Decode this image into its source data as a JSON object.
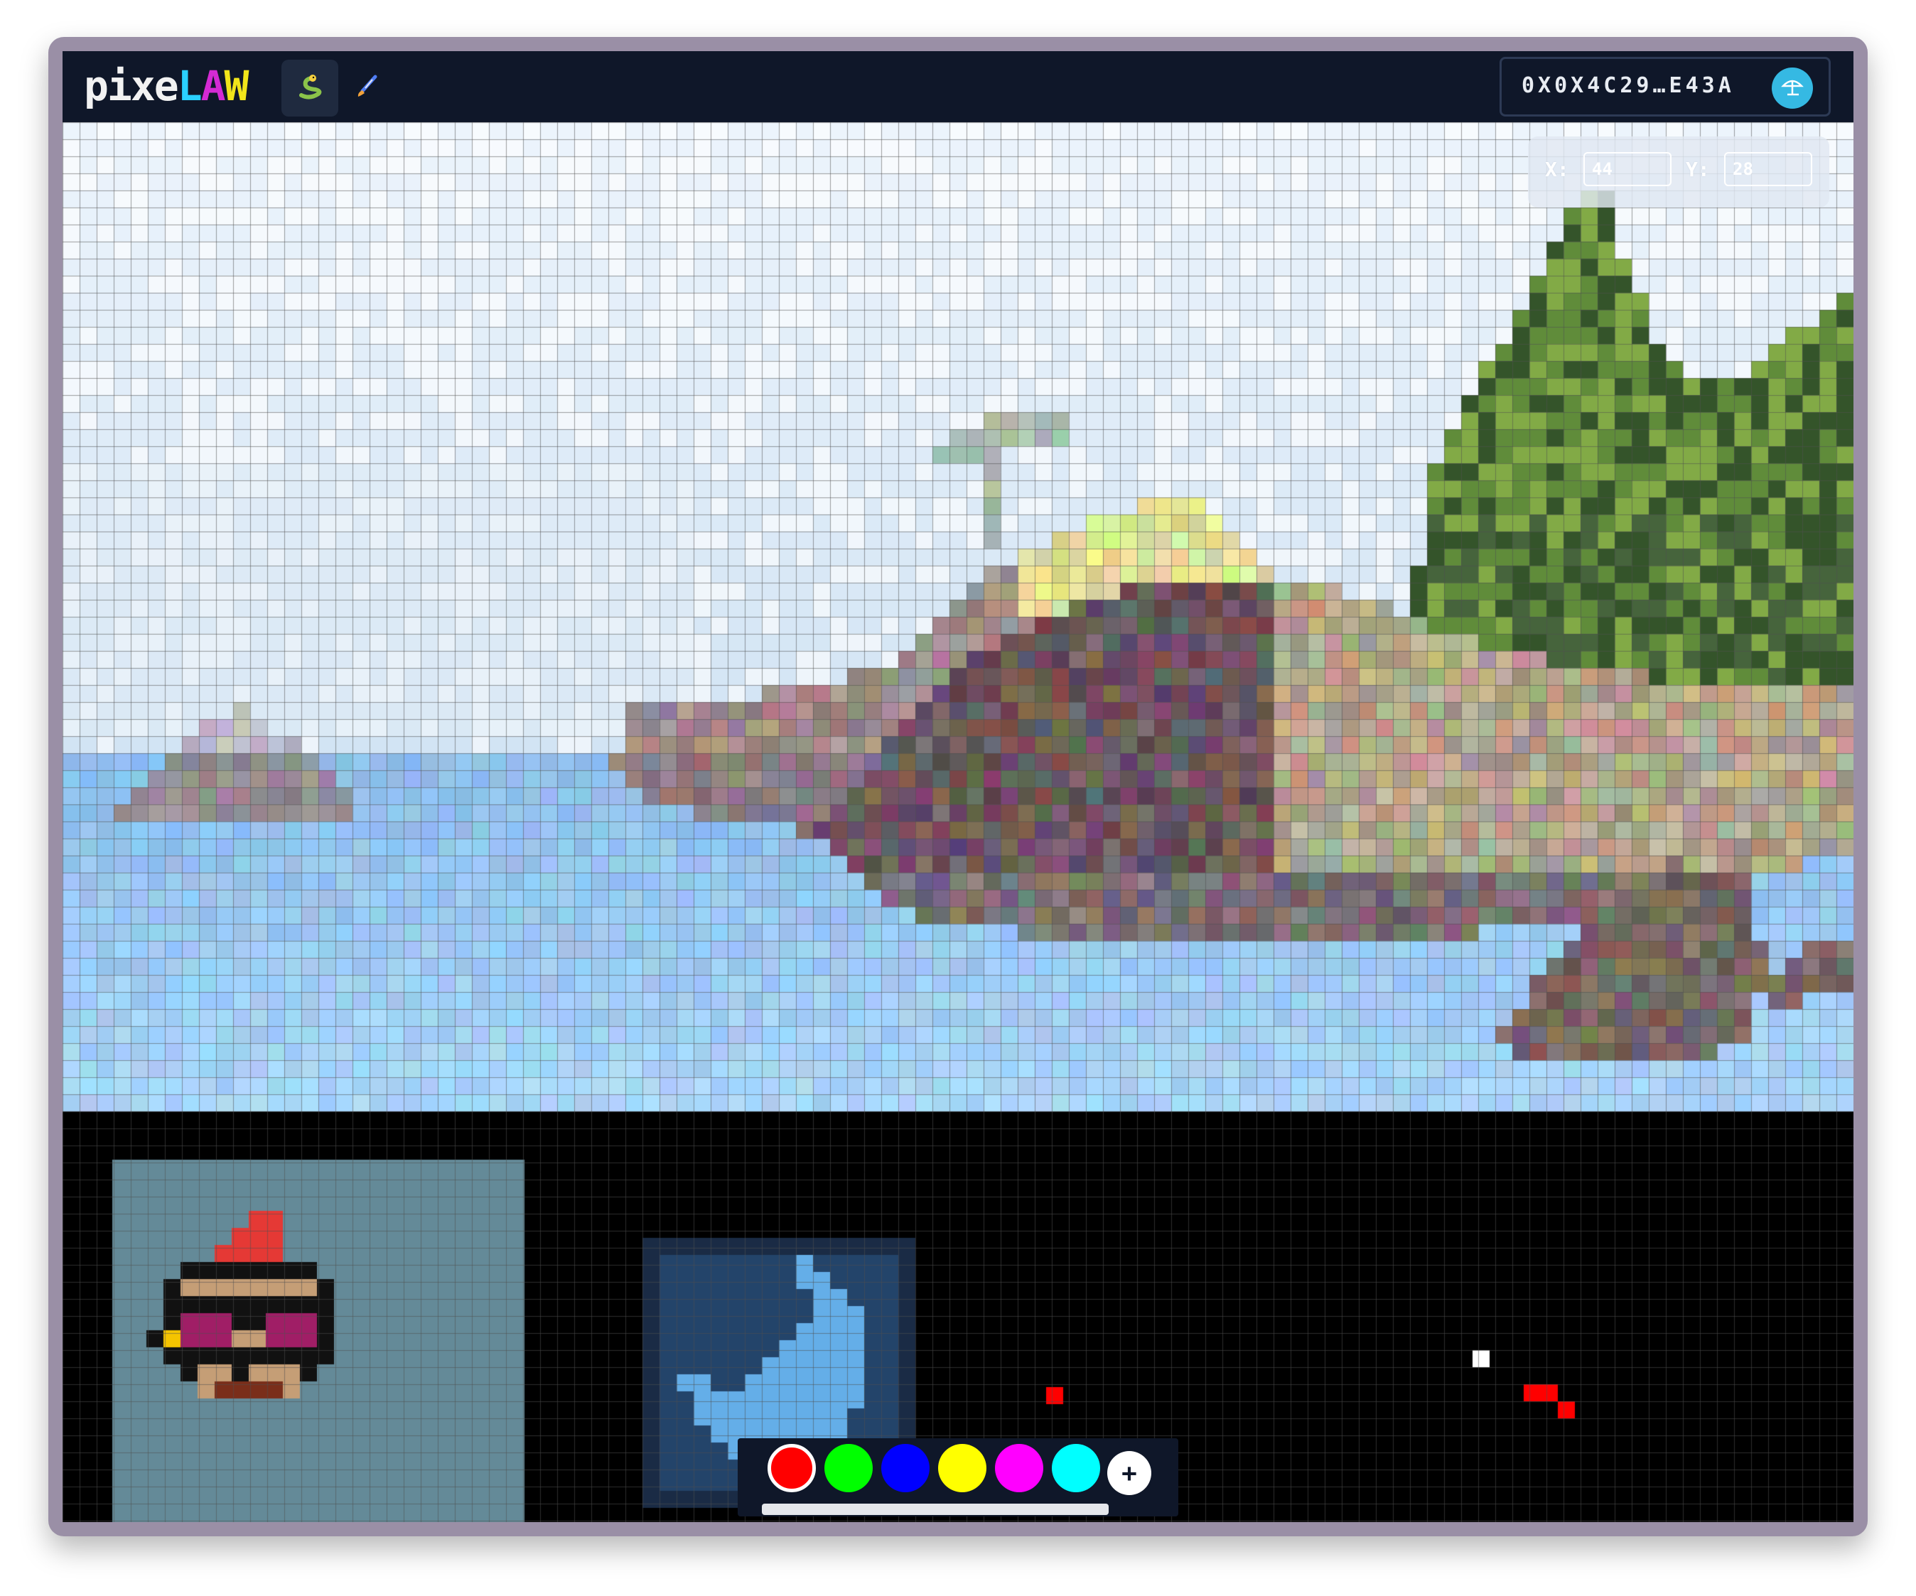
{
  "app": {
    "logo_text": "pixeLAW",
    "logo_parts": [
      "pixe",
      "L",
      "A",
      "W"
    ],
    "logo_colors": {
      "pixe": "#f2f2f2",
      "L": "#2ad0ff",
      "A": "#d42ad4",
      "W": "#f1e51a"
    }
  },
  "toolbar": {
    "apps": [
      {
        "name": "snake",
        "icon": "snake-icon",
        "active": true
      },
      {
        "name": "paint",
        "icon": "paintbrush-icon",
        "active": false
      }
    ]
  },
  "wallet": {
    "address": "0X0X4C29…E43A",
    "avatar_icon": "umbrella-icon",
    "avatar_color": "#35b9e3"
  },
  "coordinates": {
    "x_label": "X:",
    "x_value": "44",
    "y_label": "Y:",
    "y_value": "28"
  },
  "palette": {
    "colors": [
      "#ff0000",
      "#00ff00",
      "#0000ff",
      "#ffff00",
      "#ff00ff",
      "#00ffff"
    ],
    "selected_index": 0,
    "add_label": "+"
  },
  "colors": {
    "topbar_bg": "#0f1729",
    "grid_line": "#3a3a3a",
    "canvas_empty": "#000000"
  }
}
